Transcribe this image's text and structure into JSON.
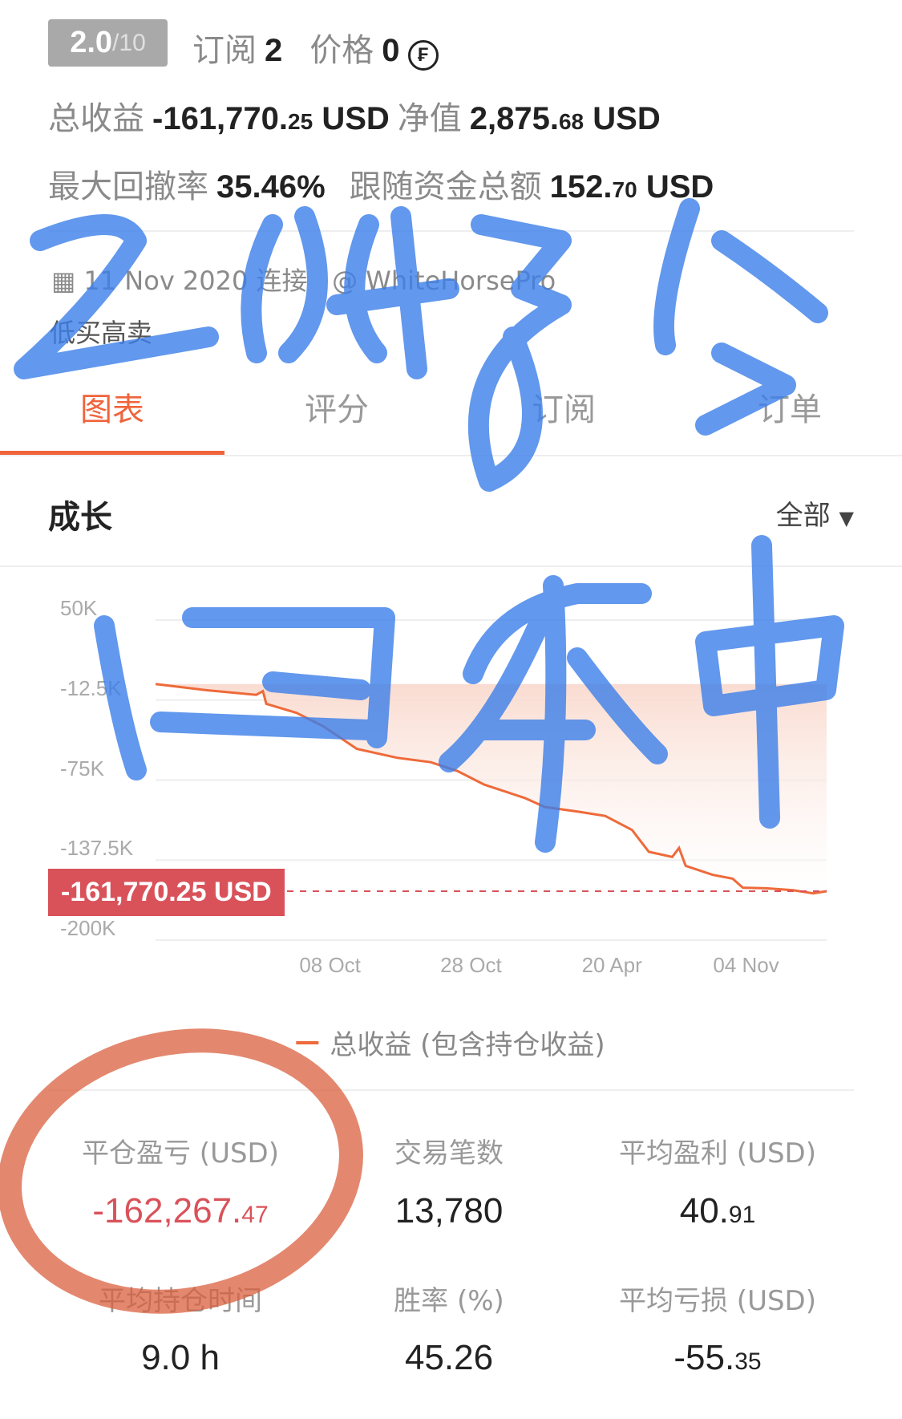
{
  "header": {
    "score": "2.0",
    "score_max": "/10",
    "subscribe_label": "订阅",
    "subscribe_count": "2",
    "price_label": "价格",
    "price_value": "0",
    "currency_icon": "coin-icon",
    "total_profit_label": "总收益",
    "total_profit_int": "-161,770.",
    "total_profit_dec": "25",
    "total_profit_unit": "USD",
    "equity_label": "净值",
    "equity_int": "2,875.",
    "equity_dec": "68",
    "equity_unit": "USD",
    "drawdown_label": "最大回撤率",
    "drawdown_value": "35.46%",
    "follow_label": "跟随资金总额",
    "follow_int": "152.",
    "follow_dec": "70",
    "follow_unit": "USD"
  },
  "info": {
    "date": "11 Nov 2020 连接",
    "account": "@ WhiteHorsePro",
    "description": "低买高卖"
  },
  "tabs": [
    {
      "label": "图表",
      "active": true
    },
    {
      "label": "评分"
    },
    {
      "label": "订阅"
    },
    {
      "label": "订单"
    }
  ],
  "section": {
    "title": "成长",
    "filter": "全部"
  },
  "colors": {
    "accent": "#f0643c",
    "line": "#ee6a3a",
    "negative": "#d9525a",
    "annotation_blue": "#3b7ee8",
    "annotation_red": "#d9603f"
  },
  "chart_data": {
    "type": "area",
    "ylim": [
      -200000,
      50000
    ],
    "yticks": [
      "50K",
      "-12.5K",
      "-75K",
      "-137.5K",
      "-200K"
    ],
    "ytick_values": [
      50000,
      -12500,
      -75000,
      -137500,
      -200000
    ],
    "xticks": [
      "08 Oct",
      "28 Oct",
      "20 Apr",
      "04 Nov"
    ],
    "xtick_positions": [
      0.26,
      0.47,
      0.68,
      0.88
    ],
    "current_label": "-161,770.25 USD",
    "current_value": -161770.25,
    "legend": "总收益 (包含持仓收益)",
    "series": [
      {
        "name": "总收益 (包含持仓收益)",
        "x": [
          0,
          0.08,
          0.15,
          0.16,
          0.165,
          0.21,
          0.25,
          0.3,
          0.36,
          0.41,
          0.45,
          0.49,
          0.55,
          0.58,
          0.63,
          0.67,
          0.71,
          0.735,
          0.77,
          0.78,
          0.79,
          0.83,
          0.86,
          0.875,
          0.91,
          0.95,
          0.98,
          1.0
        ],
        "y": [
          0,
          -5000,
          -8400,
          -5500,
          -15400,
          -22500,
          -33000,
          -50600,
          -57600,
          -61000,
          -68000,
          -78600,
          -89000,
          -96000,
          -99700,
          -103000,
          -114000,
          -131000,
          -135000,
          -128000,
          -142000,
          -149000,
          -152000,
          -159000,
          -159500,
          -161000,
          -163500,
          -161770
        ]
      }
    ]
  },
  "stats": [
    {
      "label": "平仓盈亏 (USD)",
      "int": "-162,267.",
      "dec": "47",
      "negative": true
    },
    {
      "label": "交易笔数",
      "int": "13,780",
      "dec": ""
    },
    {
      "label": "平均盈利 (USD)",
      "int": "40.",
      "dec": "91"
    },
    {
      "label": "平均持仓时间",
      "int": "9.0 h",
      "dec": ""
    },
    {
      "label": "胜率 (%)",
      "int": "45.26",
      "dec": ""
    },
    {
      "label": "平均亏损 (USD)",
      "int": "-55.",
      "dec": "35"
    }
  ]
}
